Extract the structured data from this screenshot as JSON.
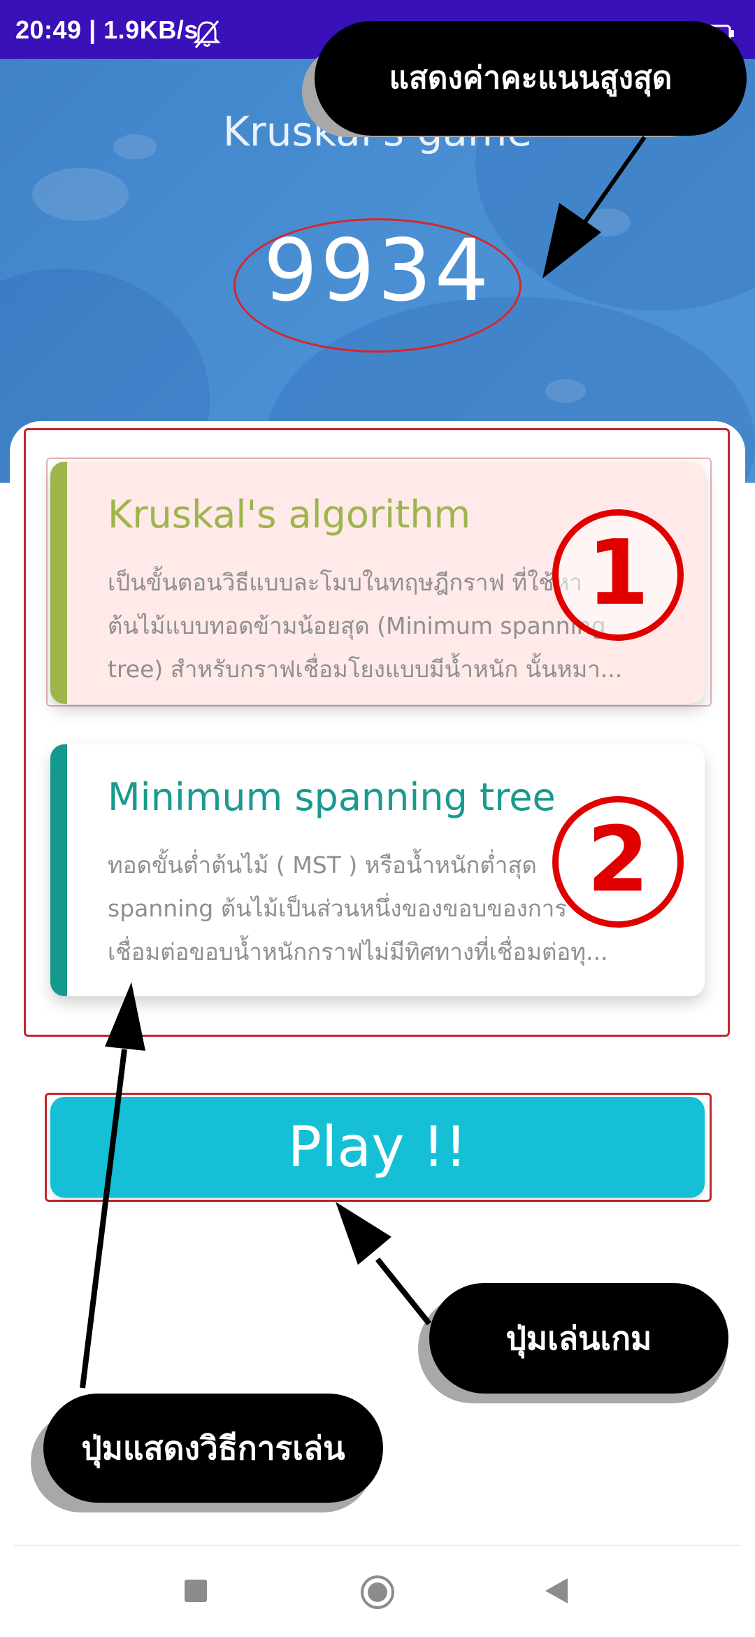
{
  "status_bar": {
    "text": "20:49 | 1.9KB/s",
    "icons": [
      "bell-off-icon",
      "battery-icon"
    ]
  },
  "header": {
    "title": "Kruskal's game",
    "high_score": "9934"
  },
  "cards": [
    {
      "title": "Kruskal's algorithm",
      "title_color": "#9db54b",
      "accent_color": "#9db54b",
      "background": "#ffe9e9",
      "lines": [
        "เป็นขั้นตอนวิธีแบบละโมบในทฤษฎีกราฟ ที่ใช้หา",
        "ต้นไม้แบบทอดข้ามน้อยสุด (Minimum spanning",
        "tree) สำหรับกราฟเชื่อมโยงแบบมีน้ำหนัก นั้นหมา..."
      ],
      "marker": "1"
    },
    {
      "title": "Minimum spanning tree",
      "title_color": "#1a9a8e",
      "accent_color": "#15998c",
      "background": "#ffffff",
      "lines": [
        "ทอดขั้นต่ำต้นไม้ ( MST ) หรือน้ำหนักต่ำสุด",
        "spanning ต้นไม้เป็นส่วนหนึ่งของขอบของการ",
        "เชื่อมต่อขอบน้ำหนักกราฟไม่มีทิศทางที่เชื่อมต่อทุ..."
      ],
      "marker": "2"
    }
  ],
  "play_button": {
    "label": "Play !!"
  },
  "callouts": {
    "high_score": "แสดงค่าคะแนนสูงสุด",
    "play": "ปุ่มเล่นเกม",
    "how_to": "ปุ่มแสดงวิธีการเล่น"
  },
  "nav_bar": {
    "icons": [
      "recent-apps-square-icon",
      "home-circle-icon",
      "back-triangle-icon"
    ]
  },
  "colors": {
    "status_bar": "#3a10b8",
    "header": "#4a8fd3",
    "play_button": "#15bfd6",
    "annotation_red": "#d8242f"
  }
}
